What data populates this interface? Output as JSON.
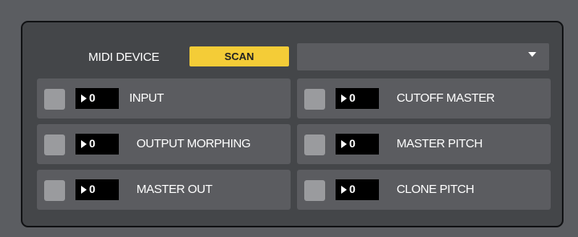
{
  "midi_device": {
    "label": "MIDI DEVICE",
    "scan_label": "SCAN",
    "selected_device": ""
  },
  "slots": [
    {
      "label": "INPUT",
      "value": "0"
    },
    {
      "label": "CUTOFF MASTER",
      "value": "0"
    },
    {
      "label": "OUTPUT MORPHING",
      "value": "0"
    },
    {
      "label": "MASTER PITCH",
      "value": "0"
    },
    {
      "label": "MASTER OUT",
      "value": "0"
    },
    {
      "label": "CLONE PITCH",
      "value": "0"
    }
  ],
  "colors": {
    "accent": "#f4cc37",
    "panel": "#444649",
    "slot": "#5b5c60"
  }
}
